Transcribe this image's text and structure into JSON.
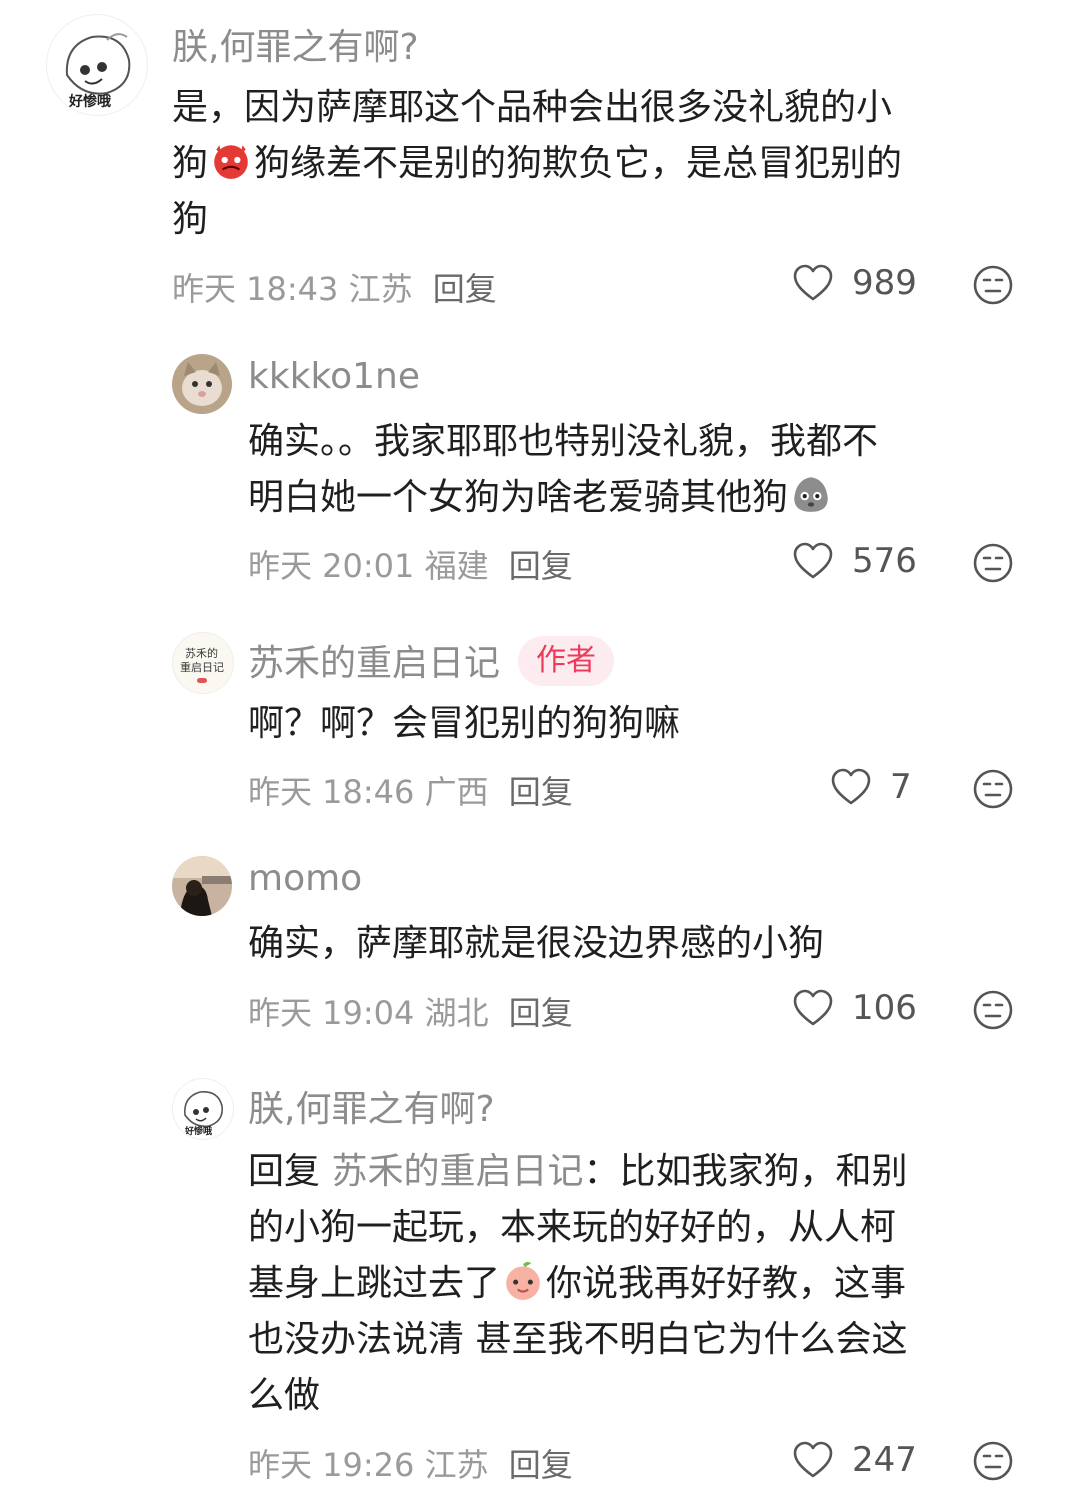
{
  "comments": [
    {
      "name": "朕,何罪之有啊?",
      "avatar_caption": "好惨哦",
      "text_lines": [
        "是，因为萨摩耶这个品种会出很多没礼貌的小",
        "狗",
        "狗缘差不是别的狗欺负它，是总冒犯别的",
        "狗"
      ],
      "date": "昨天 18:43 江苏",
      "reply_label": "回复",
      "likes": "989"
    },
    {
      "name": "kkkko1ne",
      "text_lines": [
        "确实。。我家耶耶也特别没礼貌，我都不",
        "明白她一个女狗为啥老爱骑其他狗"
      ],
      "date": "昨天 20:01 福建",
      "reply_label": "回复",
      "likes": "576"
    },
    {
      "name": "苏禾的重启日记",
      "avatar_caption_line1": "苏禾的",
      "avatar_caption_line2": "重启日记",
      "author_tag": "作者",
      "text_lines": [
        "啊？啊？会冒犯别的狗狗嘛"
      ],
      "date": "昨天 18:46 广西",
      "reply_label": "回复",
      "likes": "7"
    },
    {
      "name": "momo",
      "text_lines": [
        "确实，萨摩耶就是很没边界感的小狗"
      ],
      "date": "昨天 19:04 湖北",
      "reply_label": "回复",
      "likes": "106"
    },
    {
      "name": "朕,何罪之有啊?",
      "avatar_caption": "好惨哦",
      "reply_prefix": "回复",
      "reply_target": "苏禾的重启日记",
      "reply_sep": "：",
      "text_lines": [
        "比如我家狗，和别",
        "的小狗一起玩，本来玩的好好的，从人柯",
        "基身上跳过去了",
        "你说我再好好教，这事",
        "也没办法说清 甚至我不明白它为什么会这",
        "么做"
      ],
      "date": "昨天 19:26 江苏",
      "reply_label": "回复",
      "likes": "247"
    }
  ],
  "colors": {
    "name": "#8c8c8c",
    "meta": "#9a9a9a",
    "author_tag_bg": "#fdecef",
    "author_tag_text": "#ee3b5b"
  },
  "icons": {
    "like": "heart-outline-icon",
    "dislike": "neutral-face-icon",
    "emoji_1": "devil-face-emoji",
    "emoji_2": "grey-face-emoji",
    "emoji_3": "peach-face-emoji"
  }
}
